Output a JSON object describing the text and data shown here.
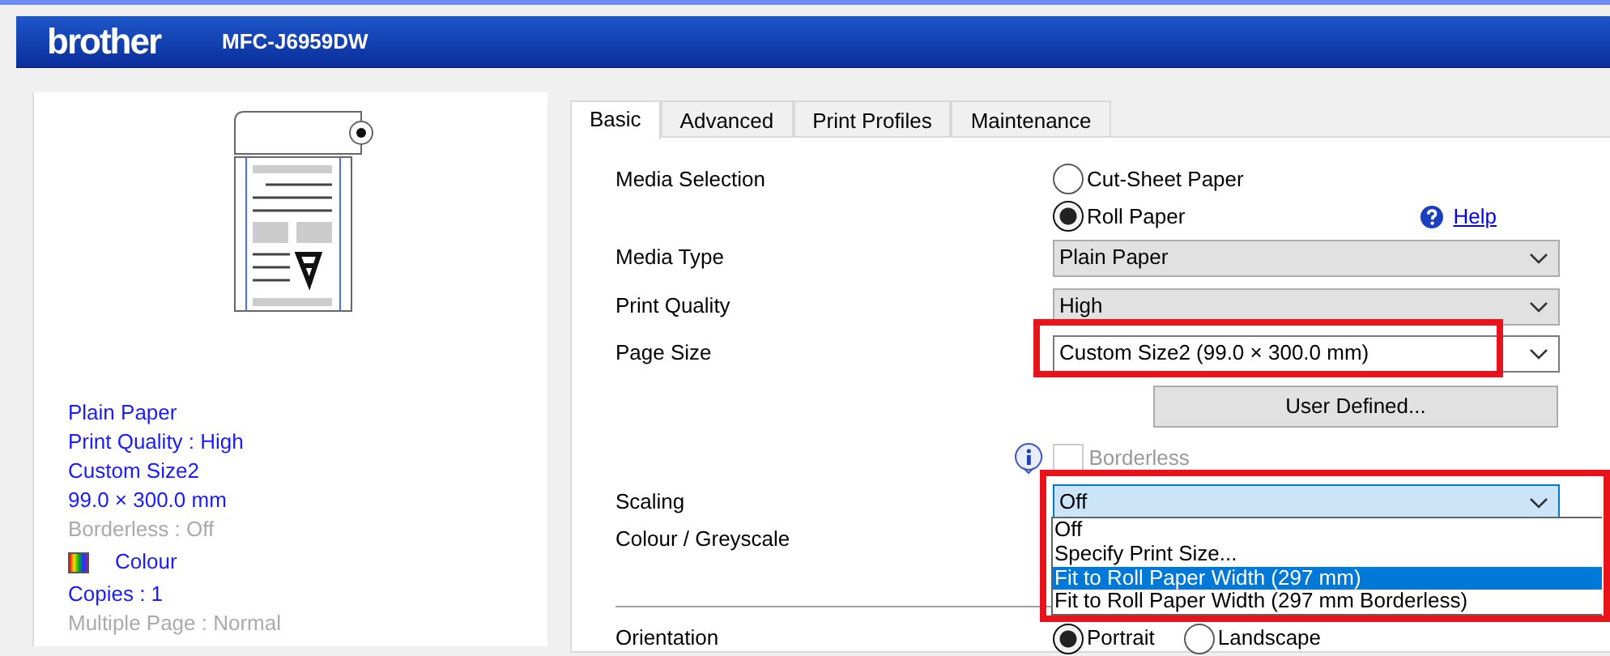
{
  "header": {
    "logo": "brother",
    "model": "MFC-J6959DW"
  },
  "summary": [
    {
      "text": "Plain Paper",
      "disabled": false,
      "kind": "text"
    },
    {
      "text": "Print Quality : High",
      "disabled": false,
      "kind": "text"
    },
    {
      "text": "Custom Size2",
      "disabled": false,
      "kind": "text"
    },
    {
      "text": "99.0 × 300.0 mm",
      "disabled": false,
      "kind": "text"
    },
    {
      "text": "Borderless : Off",
      "disabled": true,
      "kind": "text"
    },
    {
      "text": "Colour",
      "disabled": false,
      "kind": "colour"
    },
    {
      "text": "Copies : 1",
      "disabled": false,
      "kind": "text"
    },
    {
      "text": "Multiple Page : Normal",
      "disabled": true,
      "kind": "text"
    }
  ],
  "tabs": [
    {
      "label": "Basic",
      "selected": true
    },
    {
      "label": "Advanced",
      "selected": false
    },
    {
      "label": "Print Profiles",
      "selected": false
    },
    {
      "label": "Maintenance",
      "selected": false
    }
  ],
  "media_selection": {
    "label": "Media Selection",
    "options": [
      {
        "label": "Cut-Sheet Paper",
        "selected": false
      },
      {
        "label": "Roll Paper",
        "selected": true
      }
    ]
  },
  "help": "Help",
  "media_type": {
    "label": "Media Type",
    "value": "Plain Paper"
  },
  "print_quality": {
    "label": "Print Quality",
    "value": "High"
  },
  "page_size": {
    "label": "Page Size",
    "value": "Custom Size2 (99.0 × 300.0 mm)"
  },
  "user_defined_button": "User Defined...",
  "borderless": {
    "label": "Borderless",
    "checked": false,
    "disabled": true
  },
  "scaling": {
    "label": "Scaling",
    "value": "Off",
    "expanded": true,
    "options": [
      {
        "label": "Off",
        "highlighted": false
      },
      {
        "label": "Specify Print Size...",
        "highlighted": false
      },
      {
        "label": "Fit to Roll Paper Width (297 mm)",
        "highlighted": true
      },
      {
        "label": "Fit to Roll Paper Width (297 mm Borderless)",
        "highlighted": false
      }
    ]
  },
  "colour_greyscale": {
    "label": "Colour / Greyscale"
  },
  "orientation": {
    "label": "Orientation",
    "options": [
      {
        "label": "Portrait",
        "selected": true
      },
      {
        "label": "Landscape",
        "selected": false
      }
    ]
  }
}
